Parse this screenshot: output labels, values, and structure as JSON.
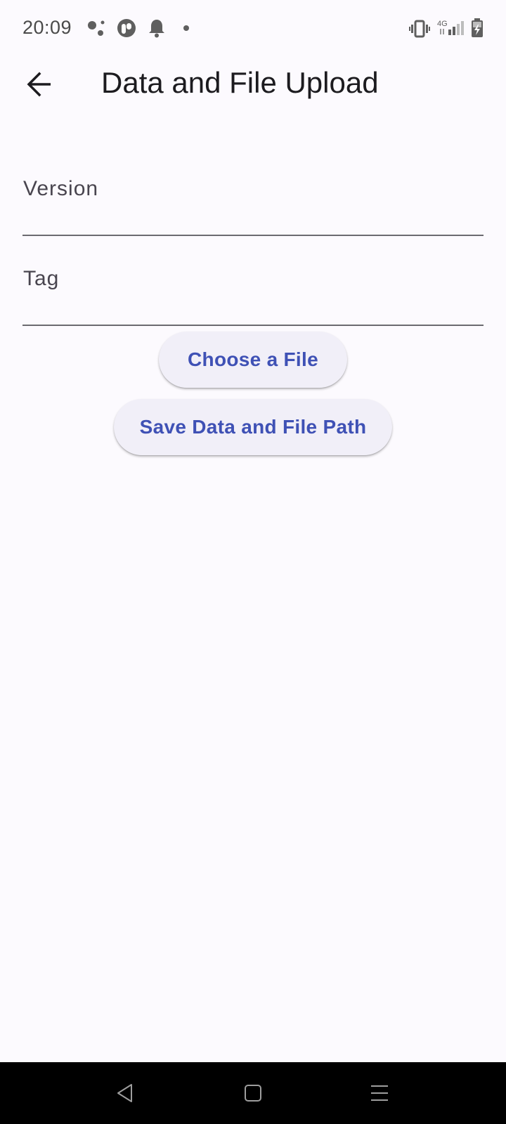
{
  "status_bar": {
    "time": "20:09",
    "network_label": "4G",
    "icons": [
      "assistant-icon",
      "app-notification-icon",
      "bell-icon",
      "dot-icon",
      "vibrate-icon",
      "signal-icon",
      "battery-charging-icon"
    ]
  },
  "app_bar": {
    "title": "Data and File Upload",
    "back_icon": "arrow-left-icon"
  },
  "form": {
    "version": {
      "label": "Version",
      "value": ""
    },
    "tag": {
      "label": "Tag",
      "value": ""
    }
  },
  "actions": {
    "choose_file_label": "Choose a File",
    "save_label": "Save Data and File Path"
  },
  "nav_bar": {
    "icons": [
      "back-triangle-icon",
      "home-square-icon",
      "menu-lines-icon"
    ]
  },
  "colors": {
    "background": "#fcfafe",
    "accent": "#3f51b5",
    "button_bg": "#f1eff8",
    "nav_bg": "#000000",
    "underline": "#6b6a70"
  }
}
